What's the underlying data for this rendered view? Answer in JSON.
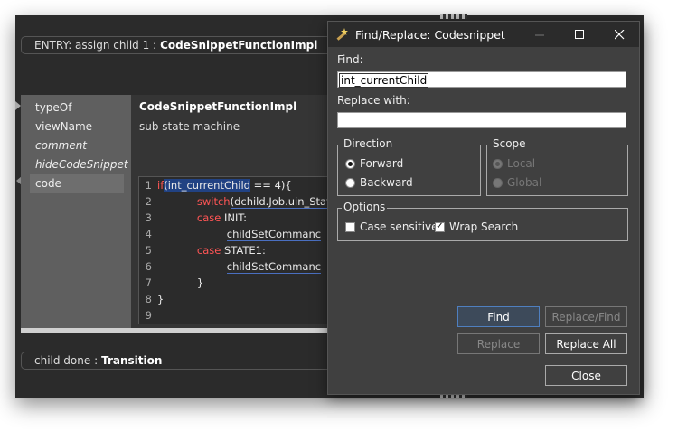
{
  "editor": {
    "entry_prefix": "ENTRY: assign child 1 :",
    "entry_type": "CodeSnippetFunctionImpl",
    "properties": [
      {
        "label": "typeOf",
        "italic": false
      },
      {
        "label": "viewName",
        "italic": false
      },
      {
        "label": "comment",
        "italic": true
      },
      {
        "label": "hideCodeSnippet",
        "italic": true
      },
      {
        "label": "code",
        "italic": false
      }
    ],
    "type_value": "CodeSnippetFunctionImpl",
    "view_name_value": "sub state machine",
    "code_line_numbers": [
      "1",
      "2",
      "3",
      "4",
      "5",
      "6",
      "7",
      "8",
      "9"
    ],
    "code": {
      "l1_kw": "if",
      "l1_hl": "(int_currentChild",
      "l1_rest": " == 4){",
      "l2_kw": "switch",
      "l2_rest": "(dchild.Job.uin_Statu",
      "l3_kw": "case",
      "l3_rest": " INIT:",
      "l4_rest": "childSetCommanc",
      "l5_kw": "case",
      "l5_rest": " STATE1:",
      "l6_rest": "childSetCommanc",
      "l7_rest": "}",
      "l8_rest": "}",
      "l9_rest": ""
    },
    "bottom_prefix": "child done :",
    "bottom_type": "Transition"
  },
  "dialog": {
    "title": "Find/Replace: Codesnippet",
    "find_label": "Find:",
    "find_value": "int_currentChild",
    "replace_label": "Replace with:",
    "replace_value": "",
    "direction_title": "Direction",
    "forward": "Forward",
    "backward": "Backward",
    "scope_title": "Scope",
    "local": "Local",
    "global": "Global",
    "options_title": "Options",
    "case_sensitive": "Case sensitive",
    "wrap_search": "Wrap Search",
    "btn_find": "Find",
    "btn_replace_find": "Replace/Find",
    "btn_replace": "Replace",
    "btn_replace_all": "Replace All",
    "btn_close": "Close",
    "minimize_icon": "minimize-icon",
    "maximize_icon": "maximize-icon",
    "close_icon": "close-icon"
  }
}
